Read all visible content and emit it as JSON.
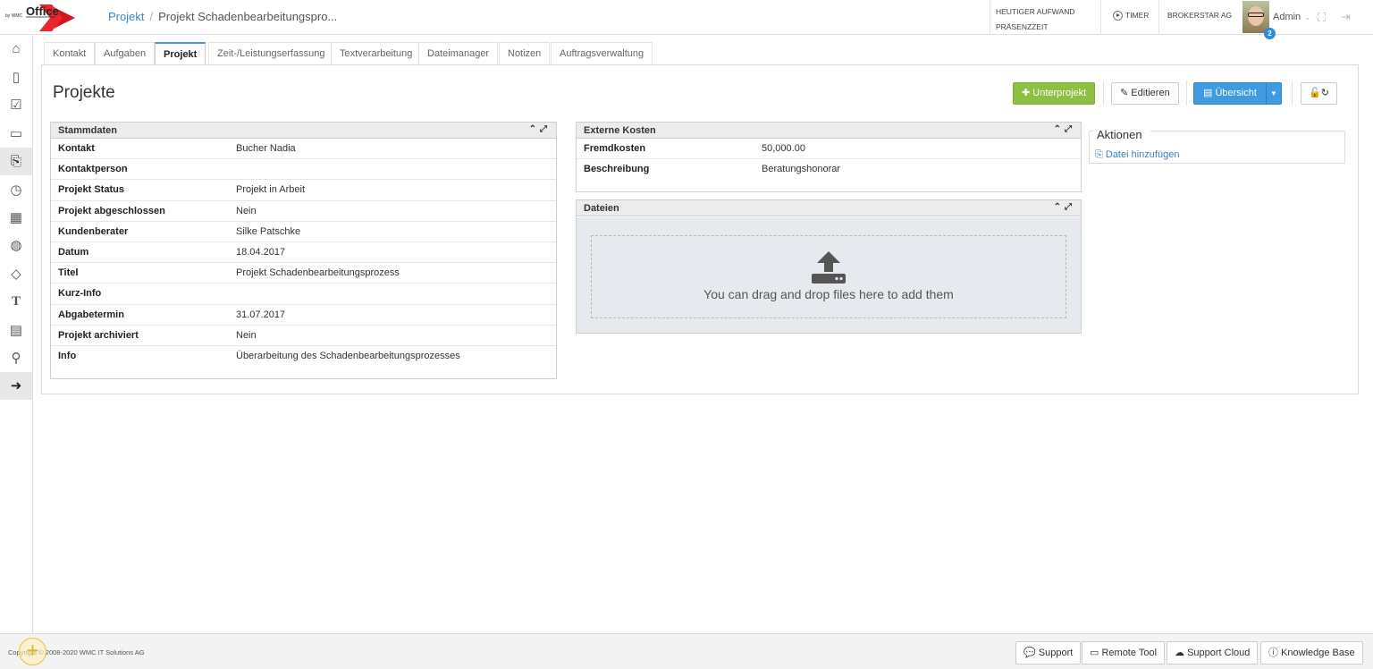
{
  "app": {
    "logo_main": "Office",
    "logo_sub": "by WMC"
  },
  "breadcrumb": {
    "link": "Projekt",
    "current": "Projekt Schadenbearbeitungspro..."
  },
  "header": {
    "aufwand": "HEUTIGER AUFWAND",
    "praesenz": "PRÄSENZZEIT",
    "timer": "TIMER",
    "company": "BROKERSTAR AG",
    "user": "Admin",
    "badge": "2"
  },
  "tabs": [
    {
      "label": "Kontakt"
    },
    {
      "label": "Aufgaben"
    },
    {
      "label": "Projekt"
    },
    {
      "label": "Zeit-/Leistungserfassung"
    },
    {
      "label": "Textverarbeitung"
    },
    {
      "label": "Dateimanager"
    },
    {
      "label": "Notizen"
    },
    {
      "label": "Auftragsverwaltung"
    }
  ],
  "page": {
    "title": "Projekte"
  },
  "toolbar": {
    "unterprojekt": "Unterprojekt",
    "editieren": "Editieren",
    "uebersicht": "Übersicht"
  },
  "stammdaten": {
    "title": "Stammdaten",
    "rows": [
      {
        "k": "Kontakt",
        "v": "Bucher Nadia"
      },
      {
        "k": "Kontaktperson",
        "v": ""
      },
      {
        "k": "Projekt Status",
        "v": "Projekt in Arbeit"
      },
      {
        "k": "Projekt abgeschlossen",
        "v": "Nein"
      },
      {
        "k": "Kundenberater",
        "v": "Silke Patschke"
      },
      {
        "k": "Datum",
        "v": "18.04.2017"
      },
      {
        "k": "Titel",
        "v": "Projekt Schadenbearbeitungsprozess"
      },
      {
        "k": "Kurz-Info",
        "v": ""
      },
      {
        "k": "Abgabetermin",
        "v": "31.07.2017"
      },
      {
        "k": "Projekt archiviert",
        "v": "Nein"
      },
      {
        "k": "Info",
        "v": "Überarbeitung des Schadenbearbeitungsprozesses"
      }
    ]
  },
  "externe": {
    "title": "Externe Kosten",
    "rows": [
      {
        "k": "Fremdkosten",
        "v": "50,000.00"
      },
      {
        "k": "Beschreibung",
        "v": "Beratungshonorar"
      }
    ]
  },
  "dateien": {
    "title": "Dateien",
    "drop": "You can drag and drop files here to add them"
  },
  "aktionen": {
    "title": "Aktionen",
    "link": "Datei hinzufügen"
  },
  "footer": {
    "copyright": "Copyright © 2008-2020 WMC IT Solutions AG",
    "support": "Support",
    "remote": "Remote Tool",
    "cloud": "Support Cloud",
    "kb": "Knowledge Base"
  },
  "colors": {
    "green": "#8dbf42",
    "blue": "#3f9ae0",
    "accent": "#4a90d9"
  },
  "sidebar_icons": [
    "home-icon",
    "book-icon",
    "checkbox-icon",
    "calendar-icon",
    "project-icon",
    "clock-icon",
    "table-icon",
    "globe-icon",
    "tag-icon",
    "text-icon",
    "form-icon",
    "key-icon",
    "arrow-right-icon"
  ]
}
